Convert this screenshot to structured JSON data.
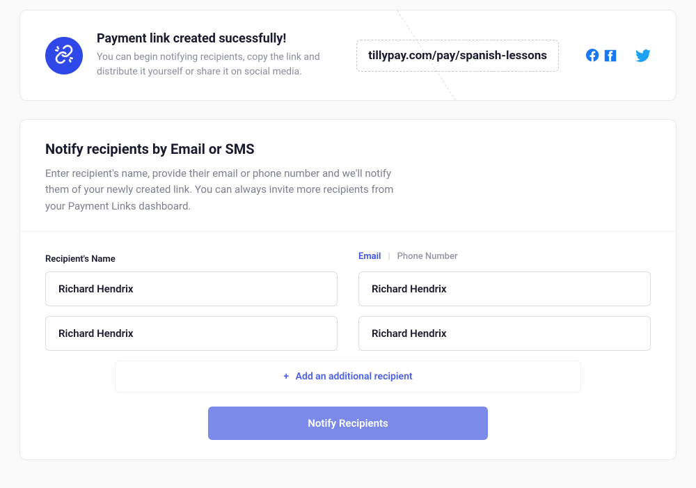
{
  "success": {
    "title": "Payment link created sucessfully!",
    "desc": "You can begin notifying recipients, copy the link and distribute it yourself or share it on social media.",
    "link": "tillypay.com/pay/spanish-lessons"
  },
  "notify": {
    "title": "Notify recipients by Email or SMS",
    "desc": "Enter recipient's name, provide their email or phone number and we'll notify them of your newly created link. You can always invite more recipients from your Payment Links dashboard.",
    "name_label": "Recipient's Name",
    "toggle": {
      "email": "Email",
      "phone": "Phone Number"
    },
    "recipients": [
      {
        "name": "Richard Hendrix",
        "contact": "Richard Hendrix"
      },
      {
        "name": "Richard Hendrix",
        "contact": "Richard Hendrix"
      }
    ],
    "add_label": "Add an additional recipient",
    "button": "Notify Recipients"
  },
  "colors": {
    "primary": "#2e49e8",
    "facebook": "#1877F2",
    "twitter": "#1DA1F2"
  }
}
